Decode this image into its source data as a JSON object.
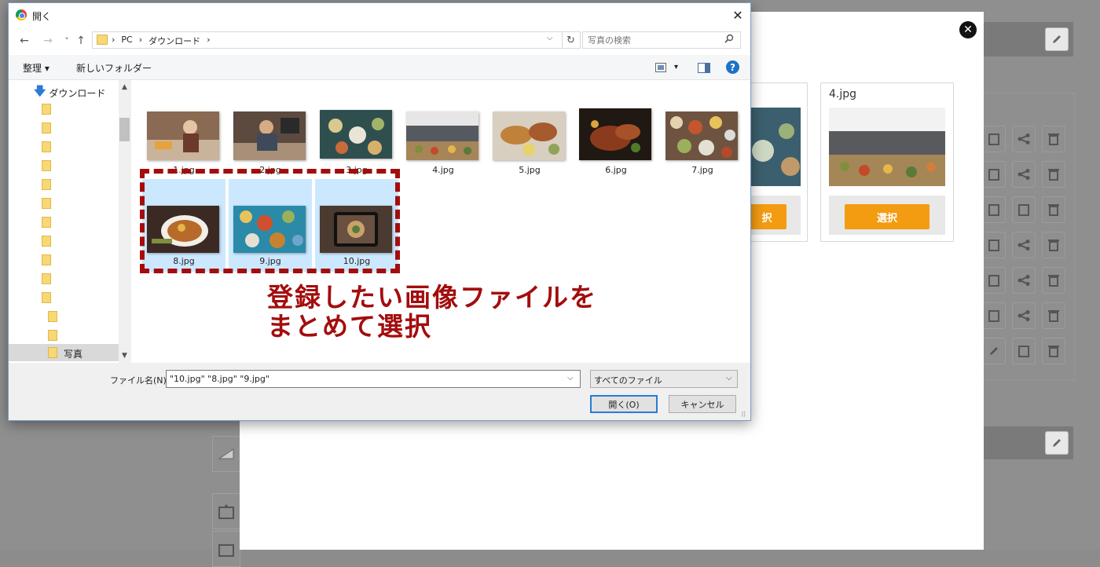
{
  "dialog": {
    "title": "開く",
    "close_glyph": "✕",
    "nav": {
      "back": "←",
      "forward": "→",
      "recent": "˅",
      "up": "↑"
    },
    "address": {
      "segments": [
        "›",
        "PC",
        "›",
        "ダウンロード",
        "›"
      ],
      "dropdown": "⌵",
      "refresh": "↻"
    },
    "search": {
      "placeholder": "写真の検索",
      "icon": "search-icon"
    },
    "toolbar": {
      "organize": "整理 ▾",
      "new_folder": "新しいフォルダー",
      "view_icon": "view-icon",
      "view_dropdown": "▾",
      "pane_icon": "preview-pane-icon",
      "help": "?"
    },
    "nav_pane": {
      "downloads": "ダウンロード",
      "selected_folder": "写真",
      "scroll_up": "▲",
      "scroll_down": "▼"
    },
    "files": [
      {
        "name": "1.jpg",
        "selected": false
      },
      {
        "name": "2.jpg",
        "selected": false
      },
      {
        "name": "3.jpg",
        "selected": false
      },
      {
        "name": "4.jpg",
        "selected": false
      },
      {
        "name": "5.jpg",
        "selected": false
      },
      {
        "name": "6.jpg",
        "selected": false
      },
      {
        "name": "7.jpg",
        "selected": false
      },
      {
        "name": "8.jpg",
        "selected": true
      },
      {
        "name": "9.jpg",
        "selected": true
      },
      {
        "name": "10.jpg",
        "selected": true
      }
    ],
    "file_name_label": "ファイル名(N):",
    "file_name_value": "\"10.jpg\" \"8.jpg\" \"9.jpg\"",
    "file_name_dropdown": "⌵",
    "file_type": "すべてのファイル",
    "file_type_dropdown": "⌵",
    "open_button": "開く(O)",
    "cancel_button": "キャンセル",
    "grip": "⠿"
  },
  "annotation": {
    "line1": "登録したい画像ファイルを",
    "line2": "まとめて選択"
  },
  "background": {
    "close_glyph": "✕",
    "card_partial_button": "択",
    "card": {
      "title": "4.jpg",
      "button": "選択"
    }
  },
  "colors": {
    "accent_orange": "#f39c12",
    "annotation_red": "#a30d0d",
    "selection_blue": "#cce8ff"
  }
}
